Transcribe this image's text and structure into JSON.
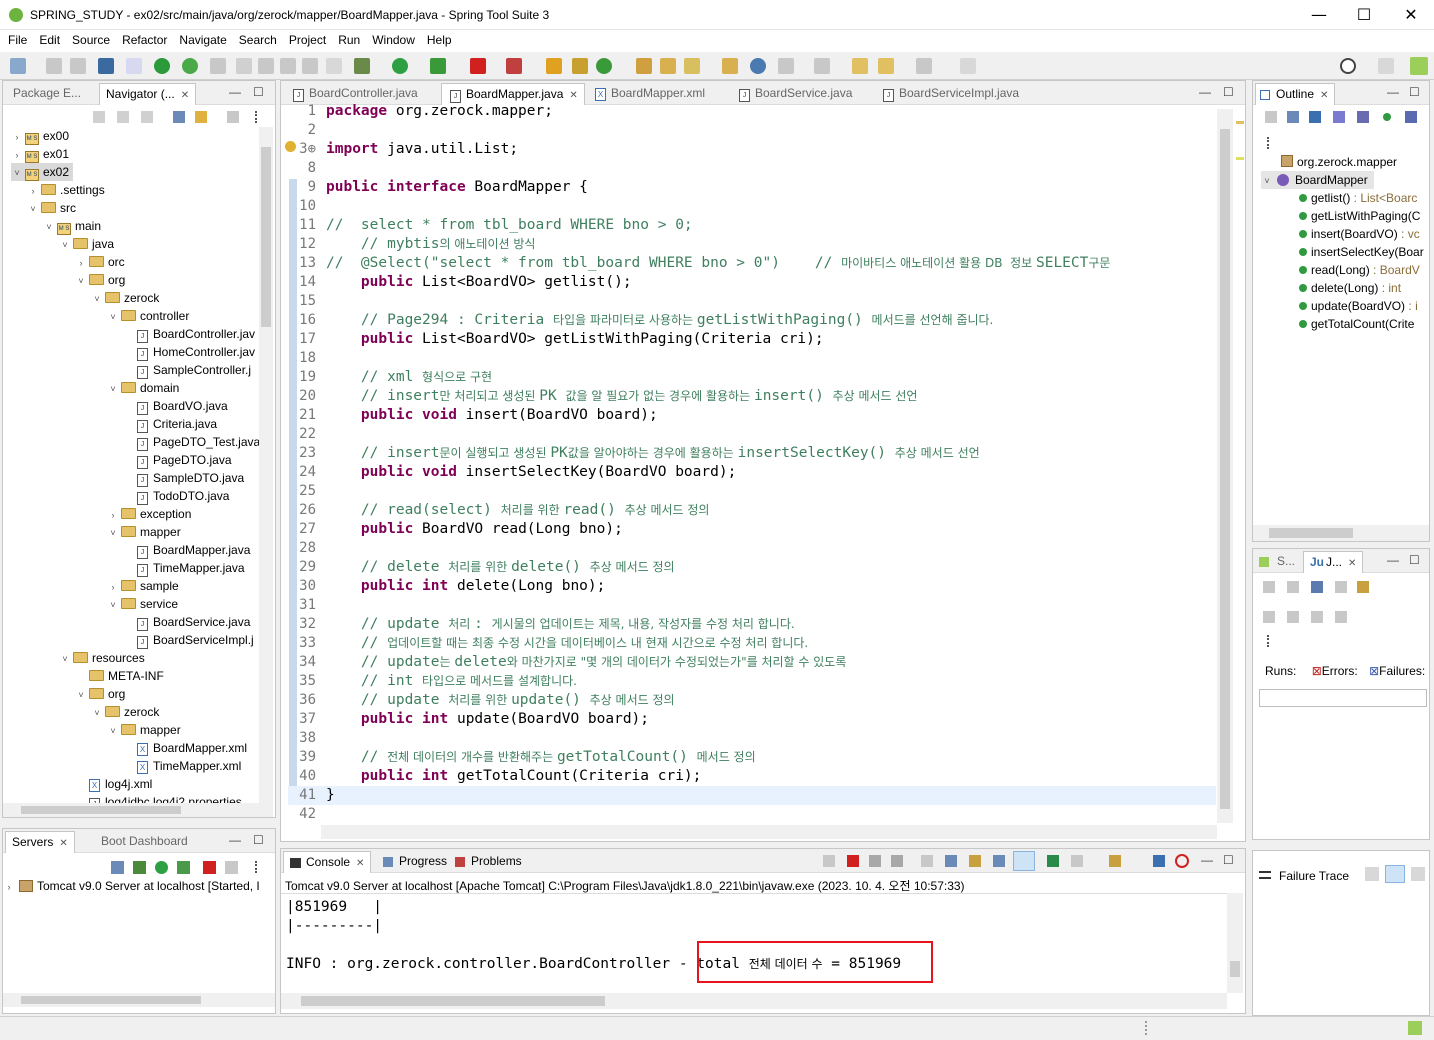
{
  "window": {
    "title": "SPRING_STUDY - ex02/src/main/java/org/zerock/mapper/BoardMapper.java - Spring Tool Suite 3",
    "minimize": "—",
    "maximize": "☐",
    "close": "✕"
  },
  "menu": [
    "File",
    "Edit",
    "Source",
    "Refactor",
    "Navigate",
    "Search",
    "Project",
    "Run",
    "Window",
    "Help"
  ],
  "left_panel": {
    "tabs": [
      {
        "label": "Package E..."
      },
      {
        "label": "Navigator (..."
      }
    ],
    "tree": [
      {
        "label": "ex00",
        "depth": 0,
        "type": "proj",
        "tw": "›"
      },
      {
        "label": "ex01",
        "depth": 0,
        "type": "proj",
        "tw": "›"
      },
      {
        "label": "ex02",
        "depth": 0,
        "type": "proj",
        "tw": "˅",
        "selected": true
      },
      {
        "label": ".settings",
        "depth": 1,
        "type": "fold",
        "tw": "›"
      },
      {
        "label": "src",
        "depth": 1,
        "type": "fold",
        "tw": "˅"
      },
      {
        "label": "main",
        "depth": 2,
        "type": "proj",
        "tw": "˅"
      },
      {
        "label": "java",
        "depth": 3,
        "type": "fold",
        "tw": "˅"
      },
      {
        "label": "orc",
        "depth": 4,
        "type": "fold",
        "tw": "›"
      },
      {
        "label": "org",
        "depth": 4,
        "type": "fold",
        "tw": "˅"
      },
      {
        "label": "zerock",
        "depth": 5,
        "type": "fold",
        "tw": "˅"
      },
      {
        "label": "controller",
        "depth": 6,
        "type": "fold",
        "tw": "˅"
      },
      {
        "label": "BoardController.jav",
        "depth": 7,
        "type": "jfile",
        "tw": ""
      },
      {
        "label": "HomeController.jav",
        "depth": 7,
        "type": "jfile",
        "tw": ""
      },
      {
        "label": "SampleController.j",
        "depth": 7,
        "type": "jfile",
        "tw": ""
      },
      {
        "label": "domain",
        "depth": 6,
        "type": "fold",
        "tw": "˅"
      },
      {
        "label": "BoardVO.java",
        "depth": 7,
        "type": "jfile",
        "tw": ""
      },
      {
        "label": "Criteria.java",
        "depth": 7,
        "type": "jfile",
        "tw": ""
      },
      {
        "label": "PageDTO_Test.java",
        "depth": 7,
        "type": "jfile",
        "tw": ""
      },
      {
        "label": "PageDTO.java",
        "depth": 7,
        "type": "jfile",
        "tw": ""
      },
      {
        "label": "SampleDTO.java",
        "depth": 7,
        "type": "jfile",
        "tw": ""
      },
      {
        "label": "TodoDTO.java",
        "depth": 7,
        "type": "jfile",
        "tw": ""
      },
      {
        "label": "exception",
        "depth": 6,
        "type": "fold",
        "tw": "›"
      },
      {
        "label": "mapper",
        "depth": 6,
        "type": "fold",
        "tw": "˅"
      },
      {
        "label": "BoardMapper.java",
        "depth": 7,
        "type": "jfile",
        "tw": ""
      },
      {
        "label": "TimeMapper.java",
        "depth": 7,
        "type": "jfile",
        "tw": ""
      },
      {
        "label": "sample",
        "depth": 6,
        "type": "fold",
        "tw": "›"
      },
      {
        "label": "service",
        "depth": 6,
        "type": "fold",
        "tw": "˅"
      },
      {
        "label": "BoardService.java",
        "depth": 7,
        "type": "jfile",
        "tw": ""
      },
      {
        "label": "BoardServiceImpl.j",
        "depth": 7,
        "type": "jfile",
        "tw": ""
      },
      {
        "label": "resources",
        "depth": 3,
        "type": "fold",
        "tw": "˅"
      },
      {
        "label": "META-INF",
        "depth": 4,
        "type": "fold",
        "tw": ""
      },
      {
        "label": "org",
        "depth": 4,
        "type": "fold",
        "tw": "˅"
      },
      {
        "label": "zerock",
        "depth": 5,
        "type": "fold",
        "tw": "˅"
      },
      {
        "label": "mapper",
        "depth": 6,
        "type": "fold",
        "tw": "˅"
      },
      {
        "label": "BoardMapper.xml",
        "depth": 7,
        "type": "xfile",
        "tw": ""
      },
      {
        "label": "TimeMapper.xml",
        "depth": 7,
        "type": "xfile",
        "tw": ""
      },
      {
        "label": "log4j.xml",
        "depth": 4,
        "type": "xfile",
        "tw": ""
      },
      {
        "label": "log4jdbc.log4j2.properties",
        "depth": 4,
        "type": "jfile",
        "tw": ""
      }
    ]
  },
  "servers": {
    "tabs": [
      {
        "label": "Servers"
      },
      {
        "label": "Boot Dashboard"
      }
    ],
    "server": "Tomcat v9.0 Server at localhost  [Started, I"
  },
  "editor": {
    "tabs": [
      {
        "label": "BoardController.java"
      },
      {
        "label": "BoardMapper.java",
        "active": true
      },
      {
        "label": "BoardMapper.xml"
      },
      {
        "label": "BoardService.java"
      },
      {
        "label": "BoardServiceImpl.java"
      }
    ],
    "lines": [
      {
        "n": "1",
        "parts": [
          [
            "kw",
            "package"
          ],
          [
            "t",
            " org.zerock.mapper;"
          ]
        ]
      },
      {
        "n": "2",
        "parts": []
      },
      {
        "n": "3⊕",
        "parts": [
          [
            "kw",
            "import"
          ],
          [
            "t",
            " java.util.List;"
          ]
        ]
      },
      {
        "n": "8",
        "parts": []
      },
      {
        "n": "9",
        "parts": [
          [
            "kw",
            "public interface"
          ],
          [
            "t",
            " BoardMapper {"
          ]
        ]
      },
      {
        "n": "10",
        "parts": []
      },
      {
        "n": "11",
        "parts": [
          [
            "cm",
            "//  select * from tbl_board WHERE bno > 0;"
          ]
        ]
      },
      {
        "n": "12",
        "parts": [
          [
            "cm",
            "    // mybtis"
          ],
          [
            "cmk",
            "의 애노테이션 방식"
          ]
        ]
      },
      {
        "n": "13",
        "parts": [
          [
            "cm",
            "//  @Select(\"select * from tbl_board WHERE bno > 0\")    // "
          ],
          [
            "cmk",
            "마이바티스 애노테이션 활용 DB  정보 "
          ],
          [
            "cm",
            "SELECT"
          ],
          [
            "cmk",
            "구문"
          ]
        ]
      },
      {
        "n": "14",
        "parts": [
          [
            "t",
            "    "
          ],
          [
            "kw",
            "public"
          ],
          [
            "t",
            " List<BoardVO> getlist();"
          ]
        ]
      },
      {
        "n": "15",
        "parts": []
      },
      {
        "n": "16",
        "parts": [
          [
            "cm",
            "    // Page294 : Criteria "
          ],
          [
            "cmk",
            "타입을 파라미터로 사용하는 "
          ],
          [
            "cm",
            "getListWithPaging() "
          ],
          [
            "cmk",
            "메서드를 선언해 줍니다."
          ]
        ]
      },
      {
        "n": "17",
        "parts": [
          [
            "t",
            "    "
          ],
          [
            "kw",
            "public"
          ],
          [
            "t",
            " List<BoardVO> getListWithPaging(Criteria cri);"
          ]
        ]
      },
      {
        "n": "18",
        "parts": []
      },
      {
        "n": "19",
        "parts": [
          [
            "cm",
            "    // xml "
          ],
          [
            "cmk",
            "형식으로 구현"
          ]
        ]
      },
      {
        "n": "20",
        "parts": [
          [
            "cm",
            "    // insert"
          ],
          [
            "cmk",
            "만 처리되고 생성된 "
          ],
          [
            "cm",
            "PK "
          ],
          [
            "cmk",
            "값을 알 필요가 없는 경우에 활용하는 "
          ],
          [
            "cm",
            "insert() "
          ],
          [
            "cmk",
            "추상 메서드 선언"
          ]
        ]
      },
      {
        "n": "21",
        "parts": [
          [
            "t",
            "    "
          ],
          [
            "kw",
            "public void"
          ],
          [
            "t",
            " insert(BoardVO board);"
          ]
        ]
      },
      {
        "n": "22",
        "parts": []
      },
      {
        "n": "23",
        "parts": [
          [
            "cm",
            "    // insert"
          ],
          [
            "cmk",
            "문이 실행되고 생성된 "
          ],
          [
            "cm",
            "PK"
          ],
          [
            "cmk",
            "값을 알아야하는 경우에 활용하는 "
          ],
          [
            "cm",
            "insertSelectKey() "
          ],
          [
            "cmk",
            "추상 메서드 선언"
          ]
        ]
      },
      {
        "n": "24",
        "parts": [
          [
            "t",
            "    "
          ],
          [
            "kw",
            "public void"
          ],
          [
            "t",
            " insertSelectKey(BoardVO board);"
          ]
        ]
      },
      {
        "n": "25",
        "parts": []
      },
      {
        "n": "26",
        "parts": [
          [
            "cm",
            "    // read(select) "
          ],
          [
            "cmk",
            "처리를 위한 "
          ],
          [
            "cm",
            "read() "
          ],
          [
            "cmk",
            "추상 메서드 정의"
          ]
        ]
      },
      {
        "n": "27",
        "parts": [
          [
            "t",
            "    "
          ],
          [
            "kw",
            "public"
          ],
          [
            "t",
            " BoardVO read(Long bno);"
          ]
        ]
      },
      {
        "n": "28",
        "parts": []
      },
      {
        "n": "29",
        "parts": [
          [
            "cm",
            "    // delete "
          ],
          [
            "cmk",
            "처리를 위한 "
          ],
          [
            "cm",
            "delete() "
          ],
          [
            "cmk",
            "추상 메서드 정의"
          ]
        ]
      },
      {
        "n": "30",
        "parts": [
          [
            "t",
            "    "
          ],
          [
            "kw",
            "public int"
          ],
          [
            "t",
            " delete(Long bno);"
          ]
        ]
      },
      {
        "n": "31",
        "parts": []
      },
      {
        "n": "32",
        "parts": [
          [
            "cm",
            "    // update "
          ],
          [
            "cmk",
            "처리 "
          ],
          [
            "cm",
            ": "
          ],
          [
            "cmk",
            "게시물의 업데이트는 제목, 내용, 작성자를 수정 처리 합니다."
          ]
        ]
      },
      {
        "n": "33",
        "parts": [
          [
            "cm",
            "    // "
          ],
          [
            "cmk",
            "업데이트할 때는 최종 수정 시간을 데이터베이스 내 현재 시간으로 수정 처리 합니다."
          ]
        ]
      },
      {
        "n": "34",
        "parts": [
          [
            "cm",
            "    // update"
          ],
          [
            "cmk",
            "는 "
          ],
          [
            "cm",
            "delete"
          ],
          [
            "cmk",
            "와 마찬가지로 \"몇 개의 데이터가 수정되었는가\"를 처리할 수 있도록"
          ]
        ]
      },
      {
        "n": "35",
        "parts": [
          [
            "cm",
            "    // int "
          ],
          [
            "cmk",
            "타입으로 메서드를 설계합니다."
          ]
        ]
      },
      {
        "n": "36",
        "parts": [
          [
            "cm",
            "    // update "
          ],
          [
            "cmk",
            "처리를 위한 "
          ],
          [
            "cm",
            "update() "
          ],
          [
            "cmk",
            "추상 메서드 정의"
          ]
        ]
      },
      {
        "n": "37",
        "parts": [
          [
            "t",
            "    "
          ],
          [
            "kw",
            "public int"
          ],
          [
            "t",
            " update(BoardVO board);"
          ]
        ]
      },
      {
        "n": "38",
        "parts": []
      },
      {
        "n": "39",
        "parts": [
          [
            "cm",
            "    // "
          ],
          [
            "cmk",
            "전체 데이터의 개수를 반환해주는 "
          ],
          [
            "cm",
            "getTotalCount() "
          ],
          [
            "cmk",
            "메서드 정의"
          ]
        ]
      },
      {
        "n": "40",
        "parts": [
          [
            "t",
            "    "
          ],
          [
            "kw",
            "public int"
          ],
          [
            "t",
            " getTotalCount(Criteria cri);"
          ]
        ]
      },
      {
        "n": "41",
        "parts": [
          [
            "t",
            "}"
          ]
        ]
      },
      {
        "n": "42",
        "parts": []
      }
    ]
  },
  "outline": {
    "tab": "Outline",
    "package": "org.zerock.mapper",
    "interface": "BoardMapper",
    "methods": [
      {
        "name": "getlist()",
        "ret": " : List<Boarc"
      },
      {
        "name": "getListWithPaging(C",
        "ret": ""
      },
      {
        "name": "insert(BoardVO)",
        "ret": " : vc"
      },
      {
        "name": "insertSelectKey(Boar",
        "ret": ""
      },
      {
        "name": "read(Long)",
        "ret": " : BoardV"
      },
      {
        "name": "delete(Long)",
        "ret": " : int"
      },
      {
        "name": "update(BoardVO)",
        "ret": " : i"
      },
      {
        "name": "getTotalCount(Crite",
        "ret": ""
      }
    ]
  },
  "junit": {
    "tabs": [
      {
        "label": "S..."
      },
      {
        "label": "J..."
      }
    ],
    "runs": "Runs:",
    "errors": "Errors:",
    "failures": "Failures:",
    "failure_trace": "Failure Trace"
  },
  "console": {
    "tabs": [
      {
        "label": "Console"
      },
      {
        "label": "Progress"
      },
      {
        "label": "Problems"
      }
    ],
    "header": "Tomcat v9.0 Server at localhost [Apache Tomcat] C:\\Program Files\\Java\\jdk1.8.0_221\\bin\\javaw.exe  (2023. 10. 4. 오전 10:57:33)",
    "line1": "|851969   |",
    "line2": "|---------|",
    "info_prefix": "INFO : org.zerock.controller.BoardController - ",
    "info_total": "total ",
    "info_kr": "전체 데이터 수",
    "info_rest": " = 851969",
    "highlight_color": "#e8141d"
  }
}
